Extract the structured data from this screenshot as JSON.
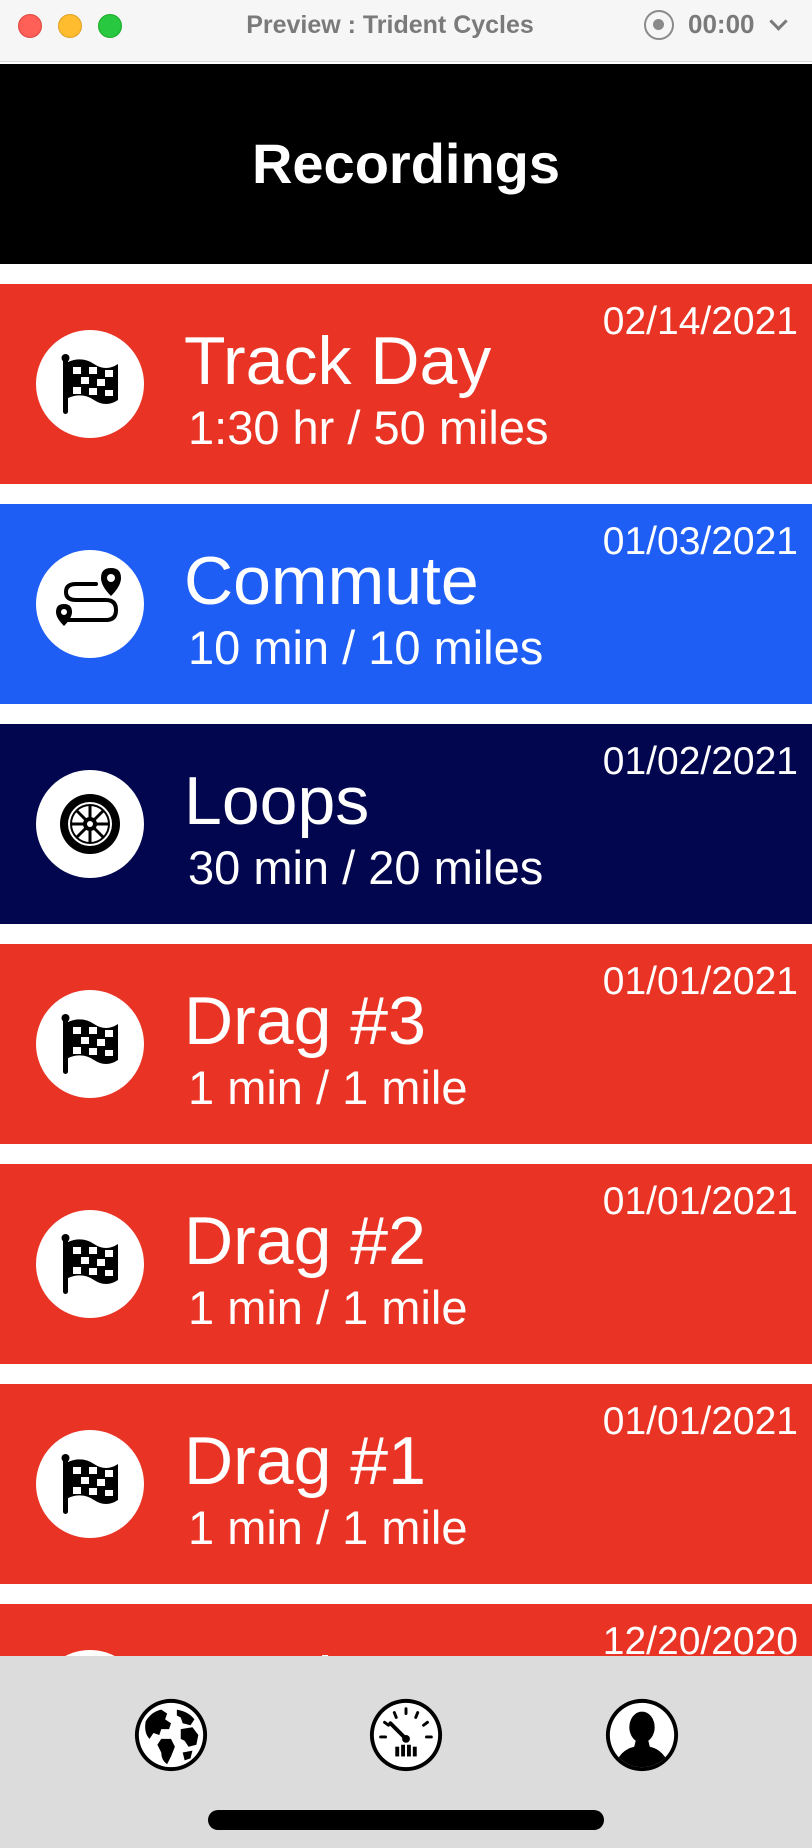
{
  "window": {
    "title": "Preview : Trident Cycles",
    "timer": "00:00"
  },
  "header": {
    "title": "Recordings"
  },
  "recordings": [
    {
      "name": "Track Day",
      "detail": "1:30 hr / 50 miles",
      "date": "02/14/2021",
      "icon": "checkered-flag-icon",
      "color": "#e93324"
    },
    {
      "name": "Commute",
      "detail": "10 min / 10 miles",
      "date": "01/03/2021",
      "icon": "route-icon",
      "color": "#1f5ef5"
    },
    {
      "name": "Loops",
      "detail": "30 min / 20 miles",
      "date": "01/02/2021",
      "icon": "wheel-icon",
      "color": "#02064f"
    },
    {
      "name": "Drag #3",
      "detail": "1 min / 1 mile",
      "date": "01/01/2021",
      "icon": "checkered-flag-icon",
      "color": "#e93324"
    },
    {
      "name": "Drag #2",
      "detail": "1 min / 1 mile",
      "date": "01/01/2021",
      "icon": "checkered-flag-icon",
      "color": "#e93324"
    },
    {
      "name": "Drag #1",
      "detail": "1 min / 1 mile",
      "date": "01/01/2021",
      "icon": "checkered-flag-icon",
      "color": "#e93324"
    },
    {
      "name": "Track Day",
      "detail": "",
      "date": "12/20/2020",
      "icon": "checkered-flag-icon",
      "color": "#e93324"
    }
  ],
  "tabbar": {
    "tabs": [
      {
        "icon": "globe-icon"
      },
      {
        "icon": "speedometer-icon"
      },
      {
        "icon": "profile-icon"
      }
    ]
  }
}
